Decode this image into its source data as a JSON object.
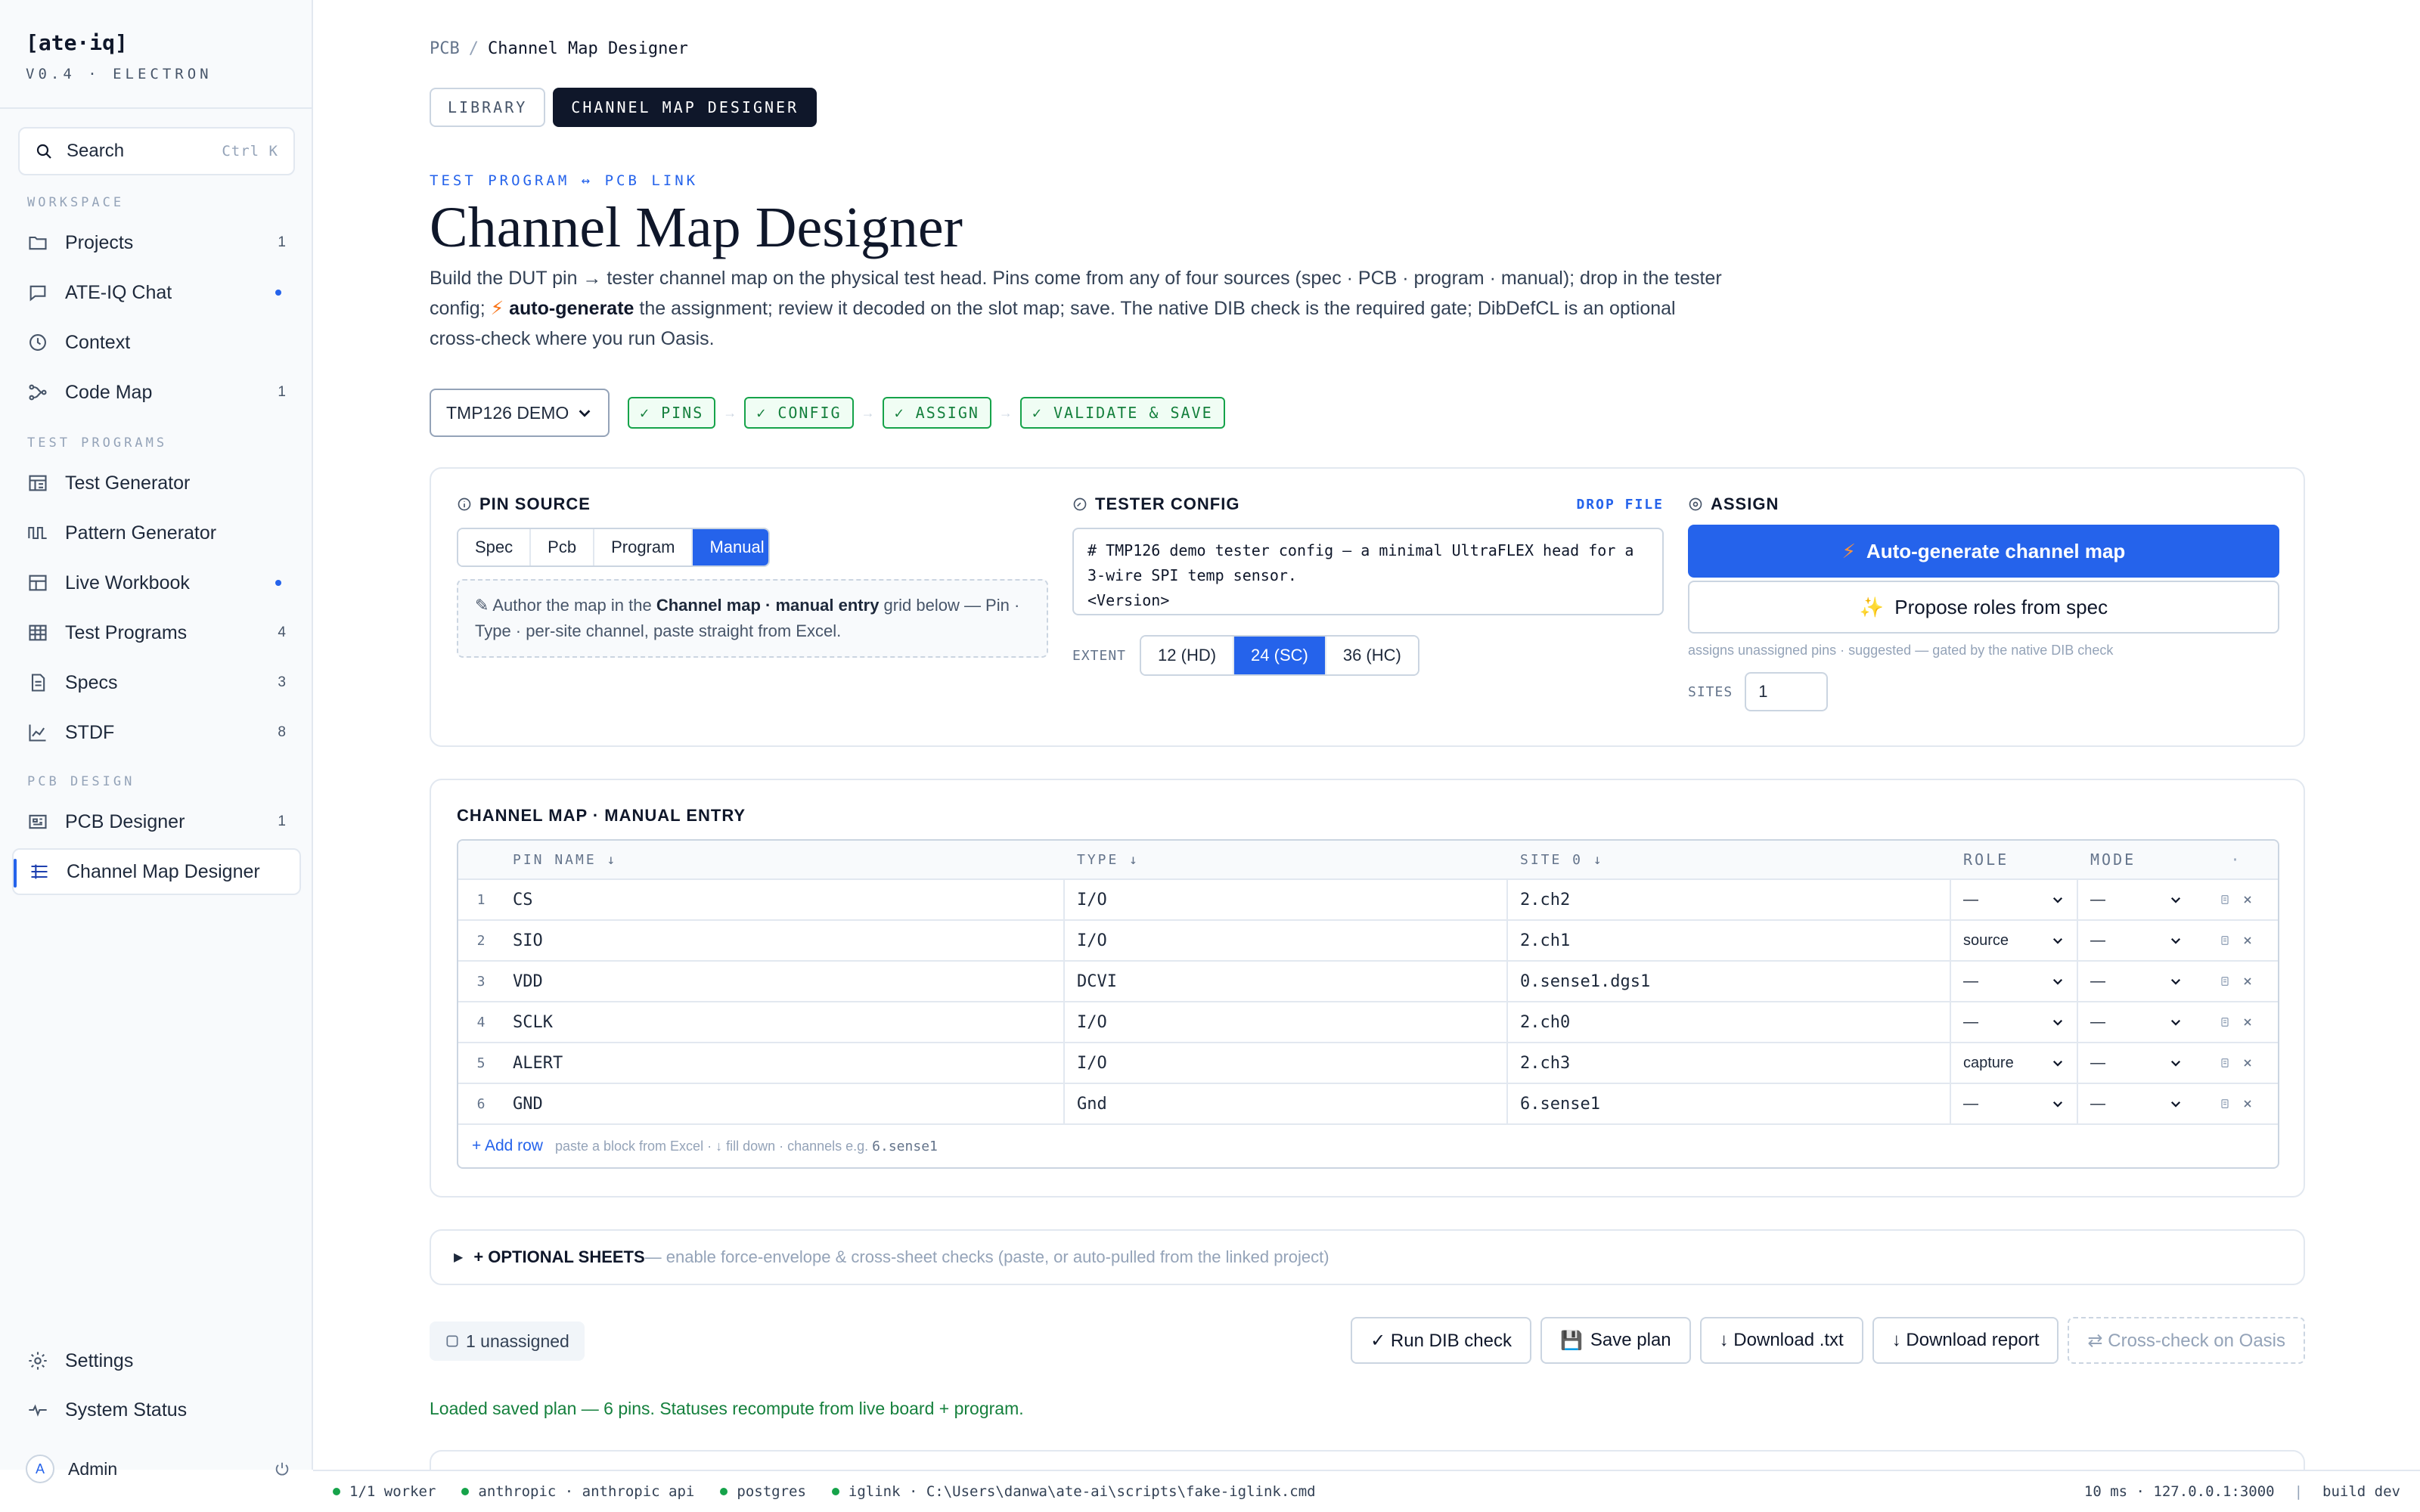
{
  "app": {
    "brand": "[ate·iq]",
    "version": "V0.4 · ELECTRON"
  },
  "search": {
    "label": "Search",
    "shortcut": "Ctrl K"
  },
  "sidebar": {
    "sections": [
      {
        "label": "WORKSPACE"
      },
      {
        "label": "TEST PROGRAMS"
      },
      {
        "label": "PCB DESIGN"
      }
    ],
    "items": [
      {
        "label": "Projects",
        "count": "1",
        "icon": "folder-icon"
      },
      {
        "label": "ATE-IQ Chat",
        "count": "",
        "icon": "chat-icon"
      },
      {
        "label": "Context",
        "count": "",
        "icon": "clock-icon"
      },
      {
        "label": "Code Map",
        "count": "1",
        "icon": "graph-icon"
      },
      {
        "label": "Test Generator",
        "count": "",
        "icon": "generator-icon"
      },
      {
        "label": "Pattern Generator",
        "count": "",
        "icon": "waveform-icon"
      },
      {
        "label": "Live Workbook",
        "count": "",
        "icon": "workbook-icon"
      },
      {
        "label": "Test Programs",
        "count": "4",
        "icon": "grid-icon"
      },
      {
        "label": "Specs",
        "count": "3",
        "icon": "document-icon"
      },
      {
        "label": "STDF",
        "count": "8",
        "icon": "chart-icon"
      },
      {
        "label": "PCB Designer",
        "count": "1",
        "icon": "board-icon"
      },
      {
        "label": "Channel Map Designer",
        "count": "",
        "icon": "channel-icon"
      }
    ],
    "settings": "Settings",
    "system_status": "System Status",
    "admin": {
      "initial": "A",
      "name": "Admin"
    }
  },
  "breadcrumb": {
    "root": "PCB",
    "sep": "/",
    "current": "Channel Map Designer"
  },
  "tabs": [
    {
      "label": "LIBRARY"
    },
    {
      "label": "CHANNEL MAP DESIGNER"
    }
  ],
  "eyebrow": "TEST PROGRAM ↔ PCB LINK",
  "title": "Channel Map Designer",
  "lede": {
    "p1": "Build the DUT pin → tester channel map on the physical test head. Pins come from any of four sources (spec · PCB · program · manual); drop in the tester config; ",
    "bold": "auto-generate",
    "p2": " the assignment; review it decoded on the slot map; save. The native DIB check is the required gate; DibDefCL is an optional cross-check where you run Oasis."
  },
  "demo_select": "TMP126 DEMO",
  "steps": [
    "✓ PINS",
    "✓ CONFIG",
    "✓ ASSIGN",
    "✓ VALIDATE & SAVE"
  ],
  "step_arrow": "→",
  "pin_source": {
    "title": "PIN SOURCE",
    "options": [
      "Spec",
      "Pcb",
      "Program",
      "Manual"
    ],
    "note_pre": "Author the map in the ",
    "note_bold": "Channel map · manual entry",
    "note_post": " grid below — Pin · Type · per-site channel, paste straight from Excel."
  },
  "tester_config": {
    "title": "TESTER CONFIG",
    "drop": "DROP FILE",
    "code_lines": [
      "# TMP126 demo tester config — a minimal UltraFLEX head for a",
      "3-wire SPI temp sensor.",
      "<Version>"
    ],
    "extent_label": "EXTENT",
    "extents": [
      "12 (HD)",
      "24 (SC)",
      "36 (HC)"
    ]
  },
  "assign": {
    "title": "ASSIGN",
    "auto_btn": "Auto-generate channel map",
    "propose_btn": "Propose roles from spec",
    "hint": "assigns unassigned pins · suggested — gated by the native DIB check",
    "sites_label": "SITES",
    "sites_value": "1"
  },
  "channel_map": {
    "title": "CHANNEL MAP · MANUAL ENTRY",
    "headers": {
      "pin": "PIN NAME ↓",
      "type": "TYPE ↓",
      "site": "SITE 0 ↓",
      "role": "ROLE",
      "mode": "MODE",
      "act": "·"
    },
    "rows": [
      {
        "n": "1",
        "pin": "CS",
        "type": "I/O",
        "site": "2.ch2",
        "role": "—",
        "mode": "—"
      },
      {
        "n": "2",
        "pin": "SIO",
        "type": "I/O",
        "site": "2.ch1",
        "role": "source",
        "mode": "—"
      },
      {
        "n": "3",
        "pin": "VDD",
        "type": "DCVI",
        "site": "0.sense1.dgs1",
        "role": "—",
        "mode": "—"
      },
      {
        "n": "4",
        "pin": "SCLK",
        "type": "I/O",
        "site": "2.ch0",
        "role": "—",
        "mode": "—"
      },
      {
        "n": "5",
        "pin": "ALERT",
        "type": "I/O",
        "site": "2.ch3",
        "role": "capture",
        "mode": "—"
      },
      {
        "n": "6",
        "pin": "GND",
        "type": "Gnd",
        "site": "6.sense1",
        "role": "—",
        "mode": "—"
      }
    ],
    "add_row": "+ Add row",
    "add_hint_pre": "paste a block from Excel · ↓ fill down · channels e.g. ",
    "add_hint_code": "6.sense1"
  },
  "optional": {
    "label": "+ OPTIONAL SHEETS",
    "desc": " — enable force-envelope & cross-sheet checks (paste, or auto-pulled from the linked project)"
  },
  "unassigned": "1 unassigned",
  "actions": {
    "run": "✓ Run DIB check",
    "save": "Save plan",
    "txt": "↓ Download .txt",
    "report": "↓ Download report",
    "oasis": "⇄ Cross-check on Oasis"
  },
  "status_msg": "Loaded saved plan — 6 pins. Statuses recompute from live board + program.",
  "statusbar": {
    "items": [
      "1/1 worker",
      "anthropic · anthropic api",
      "postgres",
      "iglink · C:\\Users\\danwa\\ate-ai\\scripts\\fake-iglink.cmd"
    ],
    "latency": "10 ms · 127.0.0.1:3000",
    "divider": "|",
    "build": "build dev"
  },
  "colors": {
    "accent": "#2563eb",
    "ok": "#16a34a",
    "ink": "#0f172a"
  }
}
